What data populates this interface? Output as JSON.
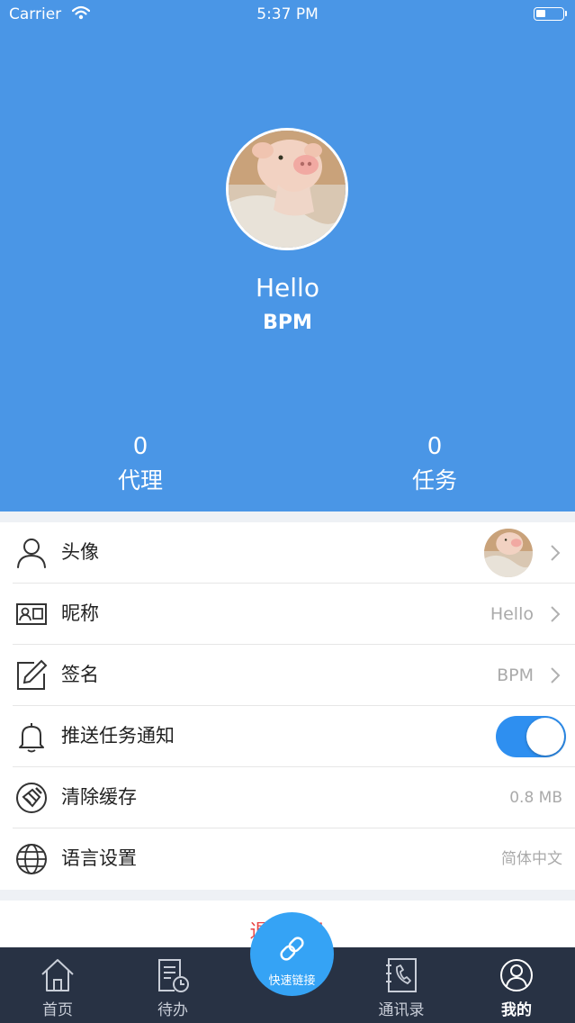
{
  "status_bar": {
    "carrier": "Carrier",
    "time": "5:37 PM"
  },
  "profile": {
    "nickname": "Hello",
    "signature": "BPM"
  },
  "stats": {
    "agent": {
      "value": "0",
      "label": "代理"
    },
    "task": {
      "value": "0",
      "label": "任务"
    }
  },
  "settings": {
    "avatar": {
      "label": "头像"
    },
    "nickname": {
      "label": "昵称",
      "value": "Hello"
    },
    "signature": {
      "label": "签名",
      "value": "BPM"
    },
    "push": {
      "label": "推送任务通知",
      "enabled": true
    },
    "cache": {
      "label": "清除缓存",
      "value": "0.8 MB"
    },
    "language": {
      "label": "语言设置",
      "value": "简体中文"
    }
  },
  "logout": {
    "label": "退出登录"
  },
  "tabbar": {
    "home": "首页",
    "todo": "待办",
    "quick_link": "快速链接",
    "contacts": "通讯录",
    "mine": "我的"
  },
  "colors": {
    "header": "#4a96e6",
    "toggle_on": "#2e8ff0",
    "logout_text": "#e84444",
    "tabbar_bg": "#283244",
    "fab": "#35a3f5"
  },
  "icons": {
    "avatar_row": "person-icon",
    "nickname_row": "id-card-icon",
    "signature_row": "pencil-icon",
    "push_row": "bell-icon",
    "cache_row": "broom-icon",
    "language_row": "globe-icon"
  }
}
